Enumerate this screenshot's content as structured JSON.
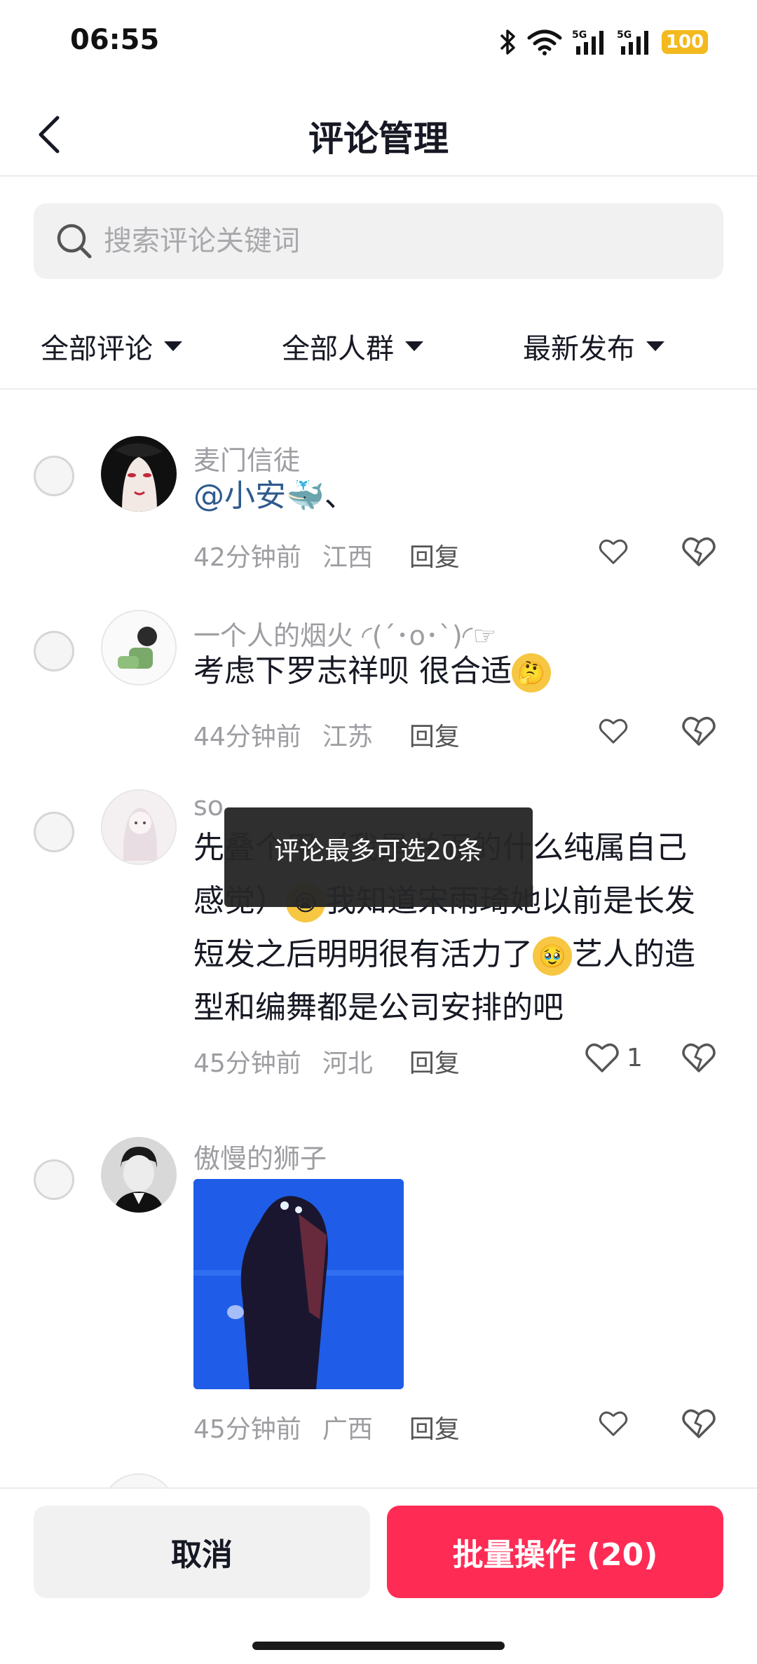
{
  "status_bar": {
    "time": "06:55",
    "battery": "100",
    "icons": [
      "bluetooth-icon",
      "wifi-icon",
      "signal-5g-icon",
      "signal-5g-icon",
      "battery-icon"
    ]
  },
  "header": {
    "title": "评论管理",
    "back_icon": "chevron-left-icon"
  },
  "search": {
    "placeholder": "搜索评论关键词"
  },
  "filters": [
    {
      "label": "全部评论"
    },
    {
      "label": "全部人群"
    },
    {
      "label": "最新发布"
    }
  ],
  "comments": [
    {
      "username": "麦门信徒",
      "text_mention": "@小安",
      "text_suffix": "🐳、",
      "time": "42分钟前",
      "location": "江西",
      "reply": "回复",
      "likes": ""
    },
    {
      "username": "一个人的烟火 ◜(ˊ･o･ˋ)◜☞",
      "text": "考虑下罗志祥呗   很合适",
      "emoji": "🤔",
      "time": "44分钟前",
      "location": "江苏",
      "reply": "回复",
      "likes": ""
    },
    {
      "username": "so",
      "text_line1": "先叠个甲（我是并面的什么纯属自己",
      "text_line2a": "感觉）",
      "emoji_a": "😭",
      "text_line2b": "我知道宋雨琦她以前是长发",
      "text_line3a": "短发之后明明很有活力了",
      "emoji_b": "🥹",
      "text_line3b": "艺人的造",
      "text_line4": "型和编舞都是公司安排的吧",
      "time": "45分钟前",
      "location": "河北",
      "reply": "回复",
      "likes": "1"
    },
    {
      "username": "傲慢的狮子",
      "time": "45分钟前",
      "location": "广西",
      "reply": "回复",
      "likes": ""
    }
  ],
  "toast": {
    "text": "评论最多可选20条"
  },
  "actions": {
    "cancel": "取消",
    "batch": "批量操作 (20)"
  },
  "colors": {
    "accent": "#fe2c55",
    "mention": "#2e5a8e",
    "battery": "#f3b91e"
  }
}
